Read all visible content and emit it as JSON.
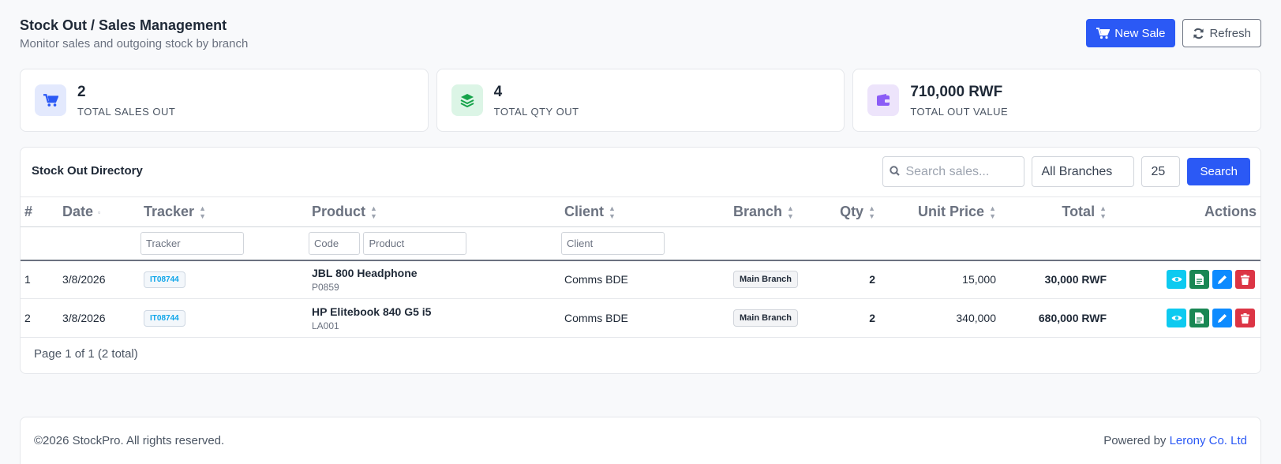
{
  "header": {
    "title": "Stock Out / Sales Management",
    "subtitle": "Monitor sales and outgoing stock by branch",
    "new_sale_label": "New Sale",
    "refresh_label": "Refresh"
  },
  "stats": [
    {
      "value": "2",
      "label": "TOTAL SALES OUT",
      "icon": "cart-icon",
      "color": "#2b59f5",
      "bg": "#e3e9fd"
    },
    {
      "value": "4",
      "label": "TOTAL QTY OUT",
      "icon": "layers-icon",
      "color": "#22c55e",
      "bg": "#dcf5e6"
    },
    {
      "value": "710,000 RWF",
      "label": "TOTAL OUT VALUE",
      "icon": "wallet-icon",
      "color": "#8b5cf6",
      "bg": "#ede4fb"
    }
  ],
  "directory": {
    "title": "Stock Out Directory",
    "search_placeholder": "Search sales...",
    "branch_filter": "All Branches",
    "page_size": "25",
    "search_label": "Search"
  },
  "table": {
    "columns": [
      "#",
      "Date",
      "Tracker",
      "Product",
      "Client",
      "Branch",
      "Qty",
      "Unit Price",
      "Total",
      "Actions"
    ],
    "filters": {
      "tracker": "Tracker",
      "code": "Code",
      "product": "Product",
      "client": "Client"
    },
    "rows": [
      {
        "num": "1",
        "date": "3/8/2026",
        "tracker": "IT08744",
        "product": "JBL 800 Headphone",
        "code": "P0859",
        "client": "Comms BDE",
        "branch": "Main Branch",
        "qty": "2",
        "unit_price": "15,000",
        "total": "30,000 RWF"
      },
      {
        "num": "2",
        "date": "3/8/2026",
        "tracker": "IT08744",
        "product": "HP Elitebook 840 G5 i5",
        "code": "LA001",
        "client": "Comms BDE",
        "branch": "Main Branch",
        "qty": "2",
        "unit_price": "340,000",
        "total": "680,000 RWF"
      }
    ]
  },
  "pagination": {
    "text": "Page 1 of 1 (2 total)"
  },
  "footer": {
    "copyright": "©2026 StockPro. All rights reserved.",
    "powered_prefix": "Powered by",
    "powered_link": "Lerony Co. Ltd"
  }
}
